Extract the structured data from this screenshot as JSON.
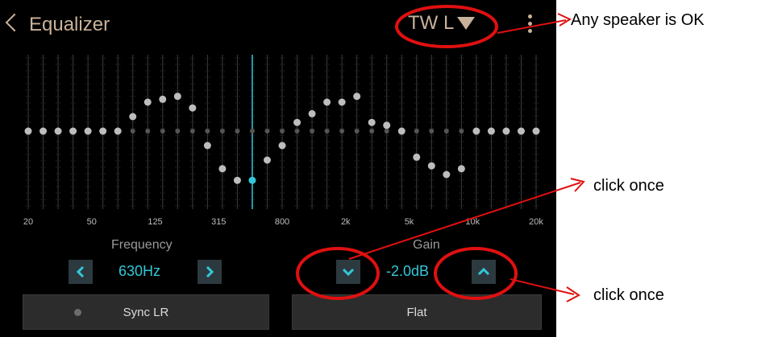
{
  "header": {
    "title": "Equalizer",
    "speaker": "TW L"
  },
  "eq": {
    "frequency_labels": [
      "20",
      "50",
      "125",
      "315",
      "800",
      "2k",
      "5k",
      "10k",
      "20k"
    ],
    "band_levels": [
      0,
      0,
      0,
      0,
      0,
      0,
      0,
      0.5,
      1,
      1.1,
      1.2,
      0.8,
      -0.5,
      -1.3,
      -1.7,
      -1.7,
      -1,
      -0.5,
      0.3,
      0.6,
      1,
      1,
      1.2,
      0.3,
      0.2,
      0,
      -0.9,
      -1.2,
      -1.5,
      -1.3,
      0,
      0,
      0,
      0,
      0
    ],
    "selected_band": 15
  },
  "frequency": {
    "label": "Frequency",
    "value": "630Hz"
  },
  "gain": {
    "label": "Gain",
    "value": "-2.0dB"
  },
  "buttons": {
    "sync": "Sync LR",
    "flat": "Flat"
  },
  "annotations": {
    "speaker_note": "Any speaker is OK",
    "click1": "click once",
    "click2": "click once"
  },
  "colors": {
    "accent": "#33c8d8",
    "header_text": "#c9b29a",
    "annotation": "#ff0000"
  }
}
